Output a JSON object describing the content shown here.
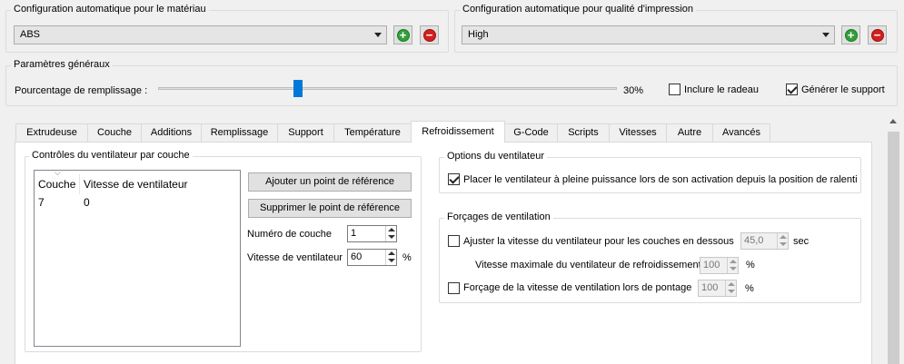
{
  "material": {
    "title": "Configuration automatique pour le matériau",
    "value": "ABS"
  },
  "quality": {
    "title": "Configuration automatique pour qualité d'impression",
    "value": "High"
  },
  "general": {
    "title": "Paramètres généraux",
    "infill_label": "Pourcentage de remplissage :",
    "infill_percent": 30,
    "infill_value": "30%",
    "raft_label": "Inclure le radeau",
    "raft_checked": false,
    "support_label": "Générer le support",
    "support_checked": true
  },
  "tabs": [
    {
      "label": "Extrudeuse",
      "active": false
    },
    {
      "label": "Couche",
      "active": false
    },
    {
      "label": "Additions",
      "active": false
    },
    {
      "label": "Remplissage",
      "active": false
    },
    {
      "label": "Support",
      "active": false
    },
    {
      "label": "Température",
      "active": false
    },
    {
      "label": "Refroidissement",
      "active": true
    },
    {
      "label": "G-Code",
      "active": false
    },
    {
      "label": "Scripts",
      "active": false
    },
    {
      "label": "Vitesses",
      "active": false
    },
    {
      "label": "Autre",
      "active": false
    },
    {
      "label": "Avancés",
      "active": false
    }
  ],
  "fan_controls": {
    "title": "Contrôles du ventilateur par couche",
    "columns": [
      "Couche",
      "Vitesse de ventilateur"
    ],
    "rows": [
      [
        "7",
        "0"
      ]
    ],
    "add_button": "Ajouter un point de référence",
    "remove_button": "Supprimer le point de référence",
    "layer_label": "Numéro de couche",
    "layer_value": "1",
    "speed_label": "Vitesse de ventilateur",
    "speed_value": "60",
    "speed_unit": "%"
  },
  "fan_options": {
    "title": "Options du ventilateur",
    "full_speed_label": "Placer le ventilateur à pleine puissance lors de son activation depuis la position de ralenti",
    "full_speed_checked": true
  },
  "cooling_overrides": {
    "title": "Forçages de ventilation",
    "adjust_label": "Ajuster la vitesse du ventilateur pour les couches en dessous",
    "adjust_checked": false,
    "adjust_value": "45,0",
    "adjust_unit": "sec",
    "max_speed_label": "Vitesse maximale du ventilateur de refroidissement",
    "max_speed_value": "100",
    "max_speed_unit": "%",
    "bridge_label": "Forçage de la vitesse de ventilation lors de pontage",
    "bridge_checked": false,
    "bridge_value": "100",
    "bridge_unit": "%"
  }
}
